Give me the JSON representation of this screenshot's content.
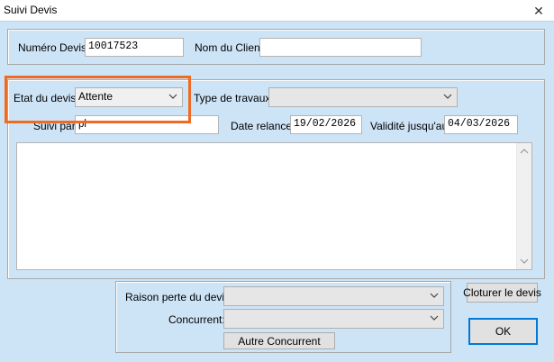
{
  "window": {
    "title": "Suivi Devis",
    "close_glyph": "✕"
  },
  "header": {
    "numero_label": "Numéro Devis:",
    "numero_value": "10017523",
    "client_label": "Nom du Client:",
    "client_value": ""
  },
  "details": {
    "etat_label": "Etat du devis:",
    "etat_value": "Attente",
    "type_label": "Type de travaux:",
    "type_value": "",
    "suivi_label": "Suivi par:",
    "suivi_value": "pl",
    "relance_label": "Date relance:",
    "relance_value": "19/02/2026",
    "validite_label": "Validité jusqu'au:",
    "validite_value": "04/03/2026",
    "notes_value": ""
  },
  "perte": {
    "raison_label": "Raison perte du devis:",
    "raison_value": "",
    "concurrent_label": "Concurrent:",
    "concurrent_value": "",
    "autre_label": "Autre Concurrent"
  },
  "buttons": {
    "cloturer_label": "Cloturer le devis",
    "ok_label": "OK"
  },
  "colors": {
    "background": "#cde4f7",
    "highlight": "#f06a22",
    "default_button_border": "#0078d7"
  },
  "icons": {
    "dropdown": "chevron-down-icon",
    "close": "close-icon",
    "scroll_up": "scroll-up-arrow-icon",
    "scroll_down": "scroll-down-arrow-icon"
  }
}
